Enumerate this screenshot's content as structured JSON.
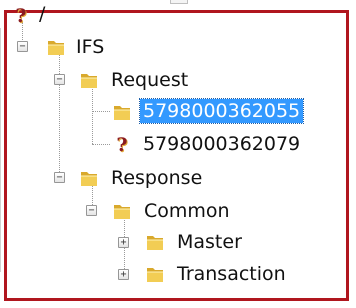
{
  "tree": {
    "root": {
      "label": "/",
      "icon": "unknown-file-icon"
    },
    "ifs": {
      "label": "IFS",
      "expanded": true,
      "expander_glyph": "−",
      "icon": "folder-icon"
    },
    "request": {
      "label": "Request",
      "expanded": true,
      "expander_glyph": "−",
      "icon": "folder-icon"
    },
    "request_item_1": {
      "label": "5798000362055",
      "selected": true,
      "icon": "folder-icon"
    },
    "request_item_2": {
      "label": "5798000362079",
      "icon": "unknown-file-icon"
    },
    "response": {
      "label": "Response",
      "expanded": true,
      "expander_glyph": "−",
      "icon": "folder-icon"
    },
    "common": {
      "label": "Common",
      "expanded": true,
      "expander_glyph": "−",
      "icon": "folder-icon"
    },
    "master": {
      "label": "Master",
      "expanded": false,
      "expander_glyph": "+",
      "icon": "folder-icon"
    },
    "transaction": {
      "label": "Transaction",
      "expanded": false,
      "expander_glyph": "+",
      "icon": "folder-icon"
    }
  },
  "colors": {
    "frame_border": "#b0161e",
    "selection_background": "#3399ff",
    "selection_text": "#ffffff",
    "folder_body": "#f2cd54",
    "unknown_glyph": "#8a1b20"
  }
}
